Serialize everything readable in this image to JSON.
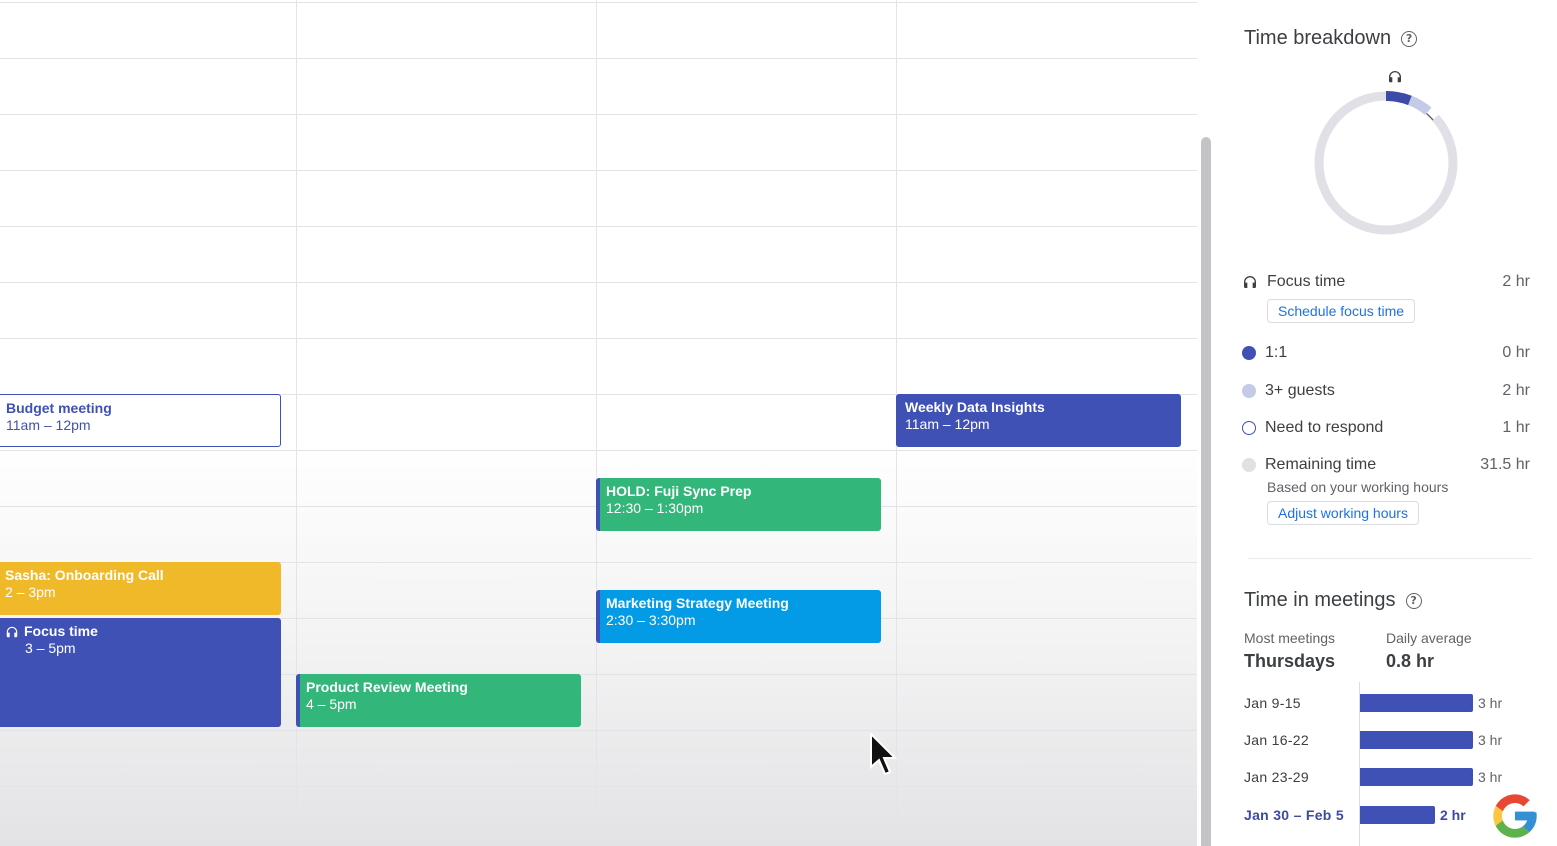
{
  "calendar": {
    "events": [
      {
        "id": "budget",
        "title": "Budget meeting",
        "time": "11am – 12pm"
      },
      {
        "id": "weekly",
        "title": "Weekly Data Insights",
        "time": "11am – 12pm"
      },
      {
        "id": "hold",
        "title": "HOLD: Fuji Sync Prep",
        "time": "12:30 – 1:30pm"
      },
      {
        "id": "sasha",
        "title": "Sasha: Onboarding Call",
        "time": "2 – 3pm"
      },
      {
        "id": "marketing",
        "title": "Marketing Strategy Meeting",
        "time": "2:30 – 3:30pm"
      },
      {
        "id": "focus",
        "title": "Focus time",
        "time": "3 – 5pm",
        "icon": "headphones-icon"
      },
      {
        "id": "product",
        "title": "Product Review Meeting",
        "time": "4 – 5pm"
      }
    ]
  },
  "panel": {
    "time_breakdown": {
      "title": "Time breakdown",
      "help_icon": "help-icon",
      "donut_icon": "headphones-icon",
      "items": [
        {
          "label": "Focus time",
          "value": "2 hr",
          "marker": "headphones-icon"
        },
        {
          "label": "1:1",
          "value": "0 hr",
          "color": "#3f51b5"
        },
        {
          "label": "3+ guests",
          "value": "2 hr",
          "color": "#c5cae9"
        },
        {
          "label": "Need to respond",
          "value": "1 hr",
          "color": "outline"
        },
        {
          "label": "Remaining time",
          "value": "31.5 hr",
          "color": "#e0e0e5"
        }
      ],
      "schedule_focus_button": "Schedule focus time",
      "remaining_note": "Based on your working hours",
      "adjust_hours_button": "Adjust working hours"
    },
    "time_in_meetings": {
      "title": "Time in meetings",
      "most_meetings_label": "Most meetings",
      "most_meetings_value": "Thursdays",
      "daily_average_label": "Daily average",
      "daily_average_value": "0.8 hr",
      "weeks": [
        {
          "label": "Jan 9-15",
          "hours": 3,
          "value": "3 hr",
          "current": false
        },
        {
          "label": "Jan 16-22",
          "hours": 3,
          "value": "3 hr",
          "current": false
        },
        {
          "label": "Jan 23-29",
          "hours": 3,
          "value": "3 hr",
          "current": false
        },
        {
          "label": "Jan 30 – Feb 5",
          "hours": 2,
          "value": "2 hr",
          "current": true
        }
      ]
    }
  },
  "colors": {
    "indigo": "#3f51b5",
    "green": "#33b679",
    "yellow": "#f0b929",
    "sky": "#039be5",
    "link": "#1a73e8"
  }
}
